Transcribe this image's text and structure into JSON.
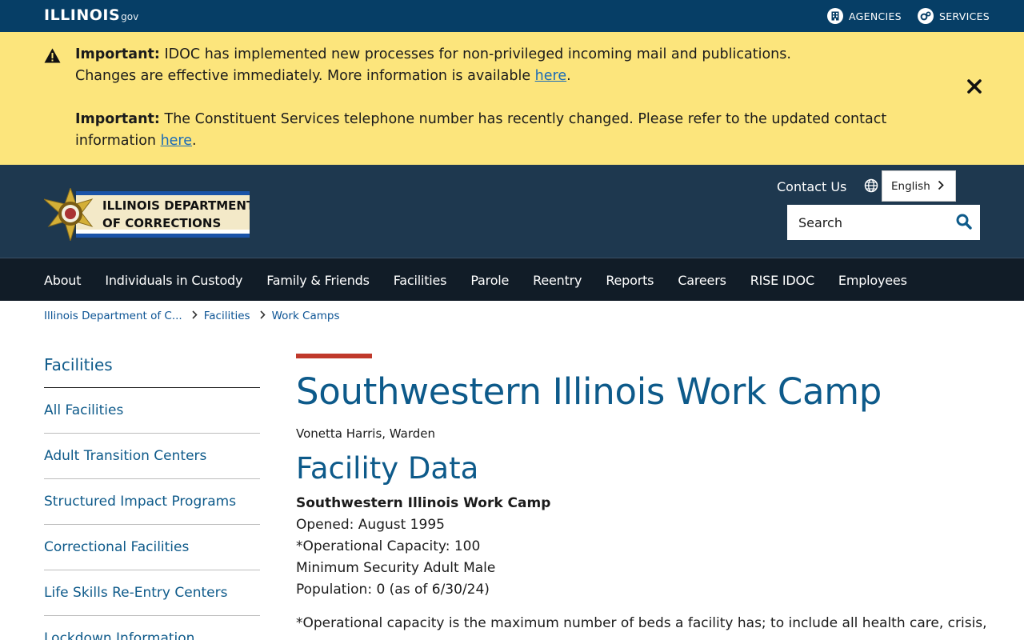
{
  "gov_bar": {
    "logo_word": "ILLINOIS",
    "logo_tld": "gov",
    "agencies_label": "AGENCIES",
    "services_label": "SERVICES"
  },
  "alert": {
    "item1_strong": "Important:",
    "item1_text": " IDOC has implemented new processes for non-privileged incoming mail and publications.",
    "item1_text2": "Changes are effective immediately. More information is available ",
    "item1_link": "here",
    "item1_end": ".",
    "item2_strong": "Important:",
    "item2_text": " The Constituent Services telephone number has recently changed. Please refer to the updated contact information ",
    "item2_link": "here",
    "item2_end": ".",
    "close_glyph": "✕"
  },
  "header": {
    "agency_line1": "ILLINOIS DEPARTMENT",
    "agency_line2": "OF CORRECTIONS",
    "contact_label": "Contact Us",
    "language": "English",
    "search_placeholder": "Search"
  },
  "nav": {
    "items": [
      "About",
      "Individuals in Custody",
      "Family & Friends",
      "Facilities",
      "Parole",
      "Reentry",
      "Reports",
      "Careers",
      "RISE IDOC",
      "Employees"
    ]
  },
  "breadcrumb": {
    "items": [
      "Illinois Department of C...",
      "Facilities",
      "Work Camps"
    ]
  },
  "sidebar": {
    "title": "Facilities",
    "items": [
      "All Facilities",
      "Adult Transition Centers",
      "Structured Impact Programs",
      "Correctional Facilities",
      "Life Skills Re-Entry Centers",
      "Lockdown Information"
    ]
  },
  "content": {
    "title": "Southwestern Illinois Work Camp",
    "warden": "Vonetta Harris, Warden",
    "section_title": "Facility Data",
    "facility_name": "Southwestern Illinois Work Camp",
    "opened": "Opened: August 1995",
    "capacity": "*Operational Capacity: 100",
    "security": "Minimum Security Adult Male",
    "population": "Population: 0 (as of 6/30/24)",
    "note": "*Operational capacity is the maximum number of beds a facility has; to include all health care, crisis,"
  },
  "colors": {
    "gov_bar": "#063e66",
    "alert_bg": "#fce57c",
    "header_bg": "#1e384f",
    "nav_bg": "#111c27",
    "heading_blue": "#0d5a8a",
    "accent_red": "#c0392b"
  }
}
